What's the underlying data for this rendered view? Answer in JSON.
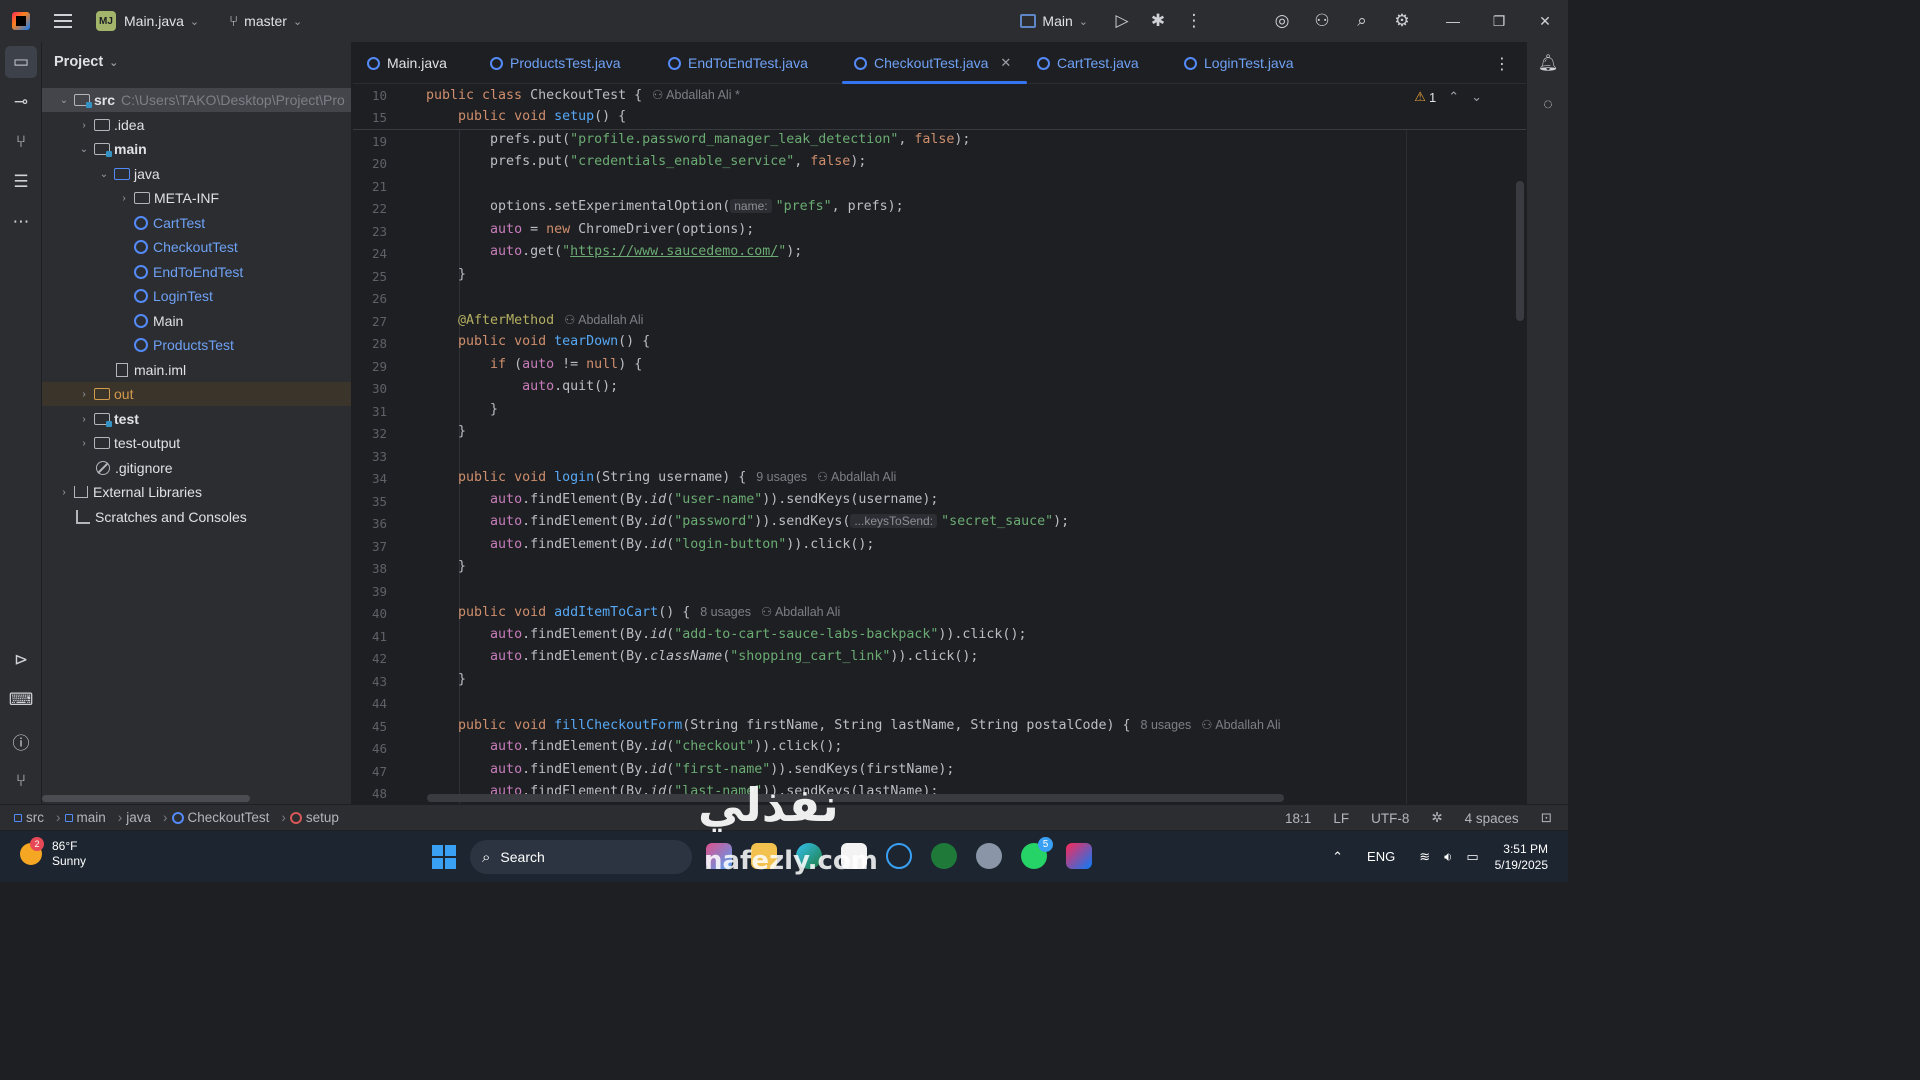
{
  "titlebar": {
    "project_badge": "MJ",
    "project_file": "Main.java",
    "branch": "master",
    "run_config": "Main"
  },
  "project_panel": {
    "title": "Project",
    "tree": [
      {
        "label": "src",
        "extra": "C:\\Users\\TAKO\\Desktop\\Project\\Pro",
        "depth": 0
      },
      {
        "label": ".idea",
        "depth": 1
      },
      {
        "label": "main",
        "depth": 1
      },
      {
        "label": "java",
        "depth": 2
      },
      {
        "label": "META-INF",
        "depth": 3
      },
      {
        "label": "CartTest",
        "depth": 3
      },
      {
        "label": "CheckoutTest",
        "depth": 3
      },
      {
        "label": "EndToEndTest",
        "depth": 3
      },
      {
        "label": "LoginTest",
        "depth": 3
      },
      {
        "label": "Main",
        "depth": 3
      },
      {
        "label": "ProductsTest",
        "depth": 3
      },
      {
        "label": "main.iml",
        "depth": 2
      },
      {
        "label": "out",
        "depth": 1
      },
      {
        "label": "test",
        "depth": 1
      },
      {
        "label": "test-output",
        "depth": 1
      },
      {
        "label": ".gitignore",
        "depth": 1
      },
      {
        "label": "External Libraries",
        "depth": 0
      },
      {
        "label": "Scratches and Consoles",
        "depth": 0
      }
    ]
  },
  "tabs": [
    {
      "label": "Main.java"
    },
    {
      "label": "ProductsTest.java"
    },
    {
      "label": "EndToEndTest.java"
    },
    {
      "label": "CheckoutTest.java",
      "active": true
    },
    {
      "label": "CartTest.java"
    },
    {
      "label": "LoginTest.java"
    }
  ],
  "editor": {
    "warning_count": "1",
    "author": "Abdallah Ali",
    "author_star": "Abdallah Ali *",
    "usages_9": "9 usages",
    "usages_8": "8 usages",
    "line_numbers": [
      "10",
      "15",
      "19",
      "20",
      "21",
      "22",
      "23",
      "24",
      "25",
      "26",
      "27",
      "28",
      "29",
      "30",
      "31",
      "32",
      "33",
      "34",
      "35",
      "36",
      "37",
      "38",
      "39",
      "40",
      "41",
      "42",
      "43",
      "44",
      "45",
      "46",
      "47",
      "48"
    ]
  },
  "statusbar": {
    "crumbs": [
      "src",
      "main",
      "java",
      "CheckoutTest",
      "setup"
    ],
    "position": "18:1",
    "line_sep": "LF",
    "encoding": "UTF-8",
    "indent": "4 spaces"
  },
  "watermark": {
    "arabic": "نفذلي",
    "latin": "nafezly.com"
  },
  "taskbar": {
    "weather_badge": "2",
    "temperature": "86°F",
    "condition": "Sunny",
    "search": "Search",
    "whatsapp_badge": "5",
    "language": "ENG",
    "time": "3:51 PM",
    "date": "5/19/2025"
  }
}
